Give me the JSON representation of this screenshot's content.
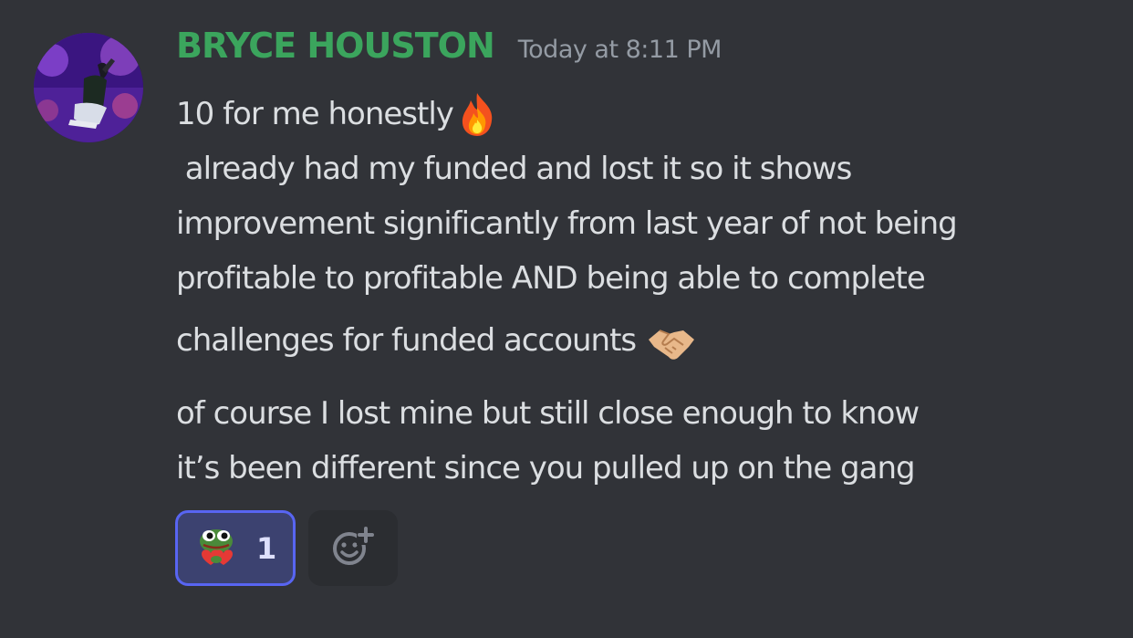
{
  "message": {
    "author": "BRYCE HOUSTON",
    "timestamp": "Today at 8:11 PM",
    "author_color": "#3ba55d",
    "lines": [
      "10 for me honestly",
      " already had my funded and lost it so it shows",
      "improvement significantly from last year of not being",
      "profitable to profitable AND being able to complete",
      "challenges for funded accounts",
      "of course I lost mine but still close enough to know",
      "it’s been different since you pulled up on the gang"
    ],
    "inline_emojis": [
      "fire-emoji",
      "handshake-emoji"
    ]
  },
  "reactions": [
    {
      "emoji": "pepe-heart-emoji",
      "count": "1",
      "selected": true
    }
  ],
  "add_reaction_icon": "add-reaction-icon",
  "colors": {
    "background": "#313338",
    "text": "#dbdee1",
    "muted": "#949ba4",
    "accent": "#5865f2"
  }
}
